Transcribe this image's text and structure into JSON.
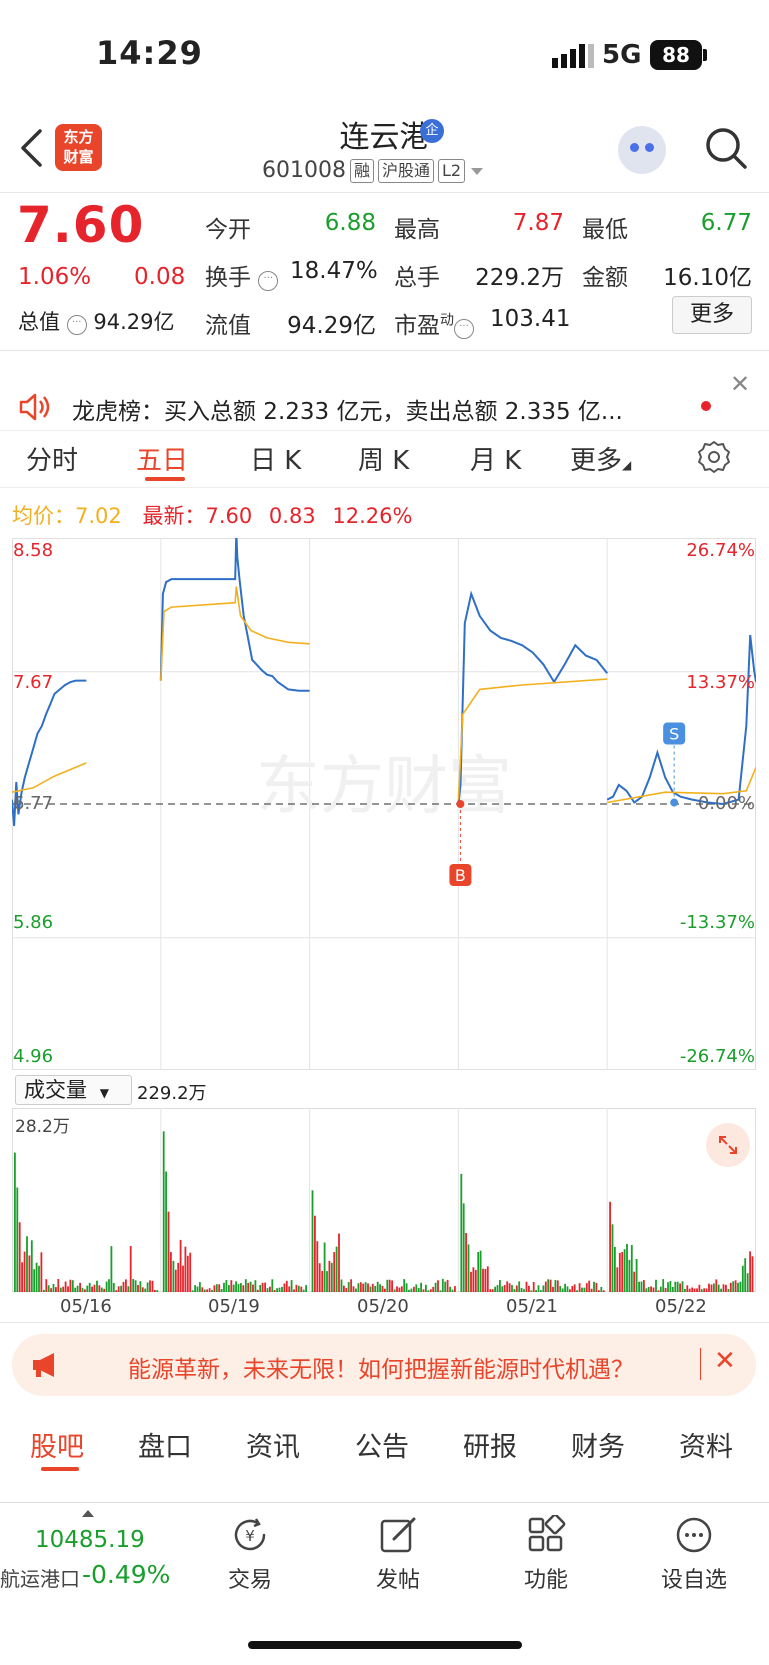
{
  "status": {
    "time": "14:29",
    "network": "5G",
    "battery": "88"
  },
  "header": {
    "logo": [
      "东方",
      "财富"
    ],
    "title": "连云港",
    "title_badge": "企",
    "code": "601008",
    "tags": [
      "融",
      "沪股通",
      "L2"
    ]
  },
  "quote": {
    "price": "7.60",
    "change_pct": "1.06%",
    "change": "0.08",
    "total_mv_label": "总值",
    "total_mv": "94.29亿",
    "open_label": "今开",
    "open": "6.88",
    "high_label": "最高",
    "high": "7.87",
    "low_label": "最低",
    "low": "6.77",
    "turnover_label": "换手",
    "turnover": "18.47%",
    "volume_label": "总手",
    "volume": "229.2万",
    "amount_label": "金额",
    "amount": "16.10亿",
    "float_mv_label": "流值",
    "float_mv": "94.29亿",
    "pe_label": "市盈",
    "pe_sup": "动",
    "pe": "103.41",
    "more": "更多"
  },
  "news": {
    "text": "龙虎榜：买入总额 2.233 亿元，卖出总额 2.335 亿..."
  },
  "chart_tabs": [
    "分时",
    "五日",
    "日 K",
    "周 K",
    "月 K",
    "更多"
  ],
  "chart_header": {
    "avg_label": "均价：",
    "avg": "7.02",
    "latest_label": "最新：",
    "latest": "7.60",
    "latest_change": "0.83",
    "latest_pct": "12.26%"
  },
  "chart_data": {
    "type": "line",
    "x": [
      "05/16",
      "05/19",
      "05/20",
      "05/21",
      "05/22"
    ],
    "series": [
      {
        "name": "价格",
        "color": "#2f6fc6"
      },
      {
        "name": "均价",
        "color": "#f2b01e"
      }
    ],
    "ylim": [
      4.96,
      8.58
    ],
    "y_ticks_left": [
      "8.58",
      "7.67",
      "6.77",
      "5.86",
      "4.96"
    ],
    "y_ticks_right": [
      "26.74%",
      "13.37%",
      "0.00%",
      "-13.37%",
      "-26.74%"
    ],
    "prev_close": 6.77,
    "markers": [
      {
        "label": "B",
        "color": "#e8452a"
      },
      {
        "label": "S",
        "color": "#4a8fe0"
      }
    ],
    "watermark": "东方财富"
  },
  "volume": {
    "selector": "成交量",
    "total": "229.2万",
    "max_label": "28.2万"
  },
  "promo": {
    "text": "能源革新，未来无限！如何把握新能源时代机遇？"
  },
  "bottom_tabs": [
    "股吧",
    "盘口",
    "资讯",
    "公告",
    "研报",
    "财务",
    "资料"
  ],
  "bottom_bar": {
    "index_value": "10485.19",
    "index_name": "航运港口",
    "index_change": "-0.49%",
    "actions": [
      {
        "label": "交易",
        "icon": "yen-icon"
      },
      {
        "label": "发帖",
        "icon": "edit-icon"
      },
      {
        "label": "功能",
        "icon": "grid-icon"
      },
      {
        "label": "设自选",
        "icon": "more-icon"
      }
    ]
  }
}
